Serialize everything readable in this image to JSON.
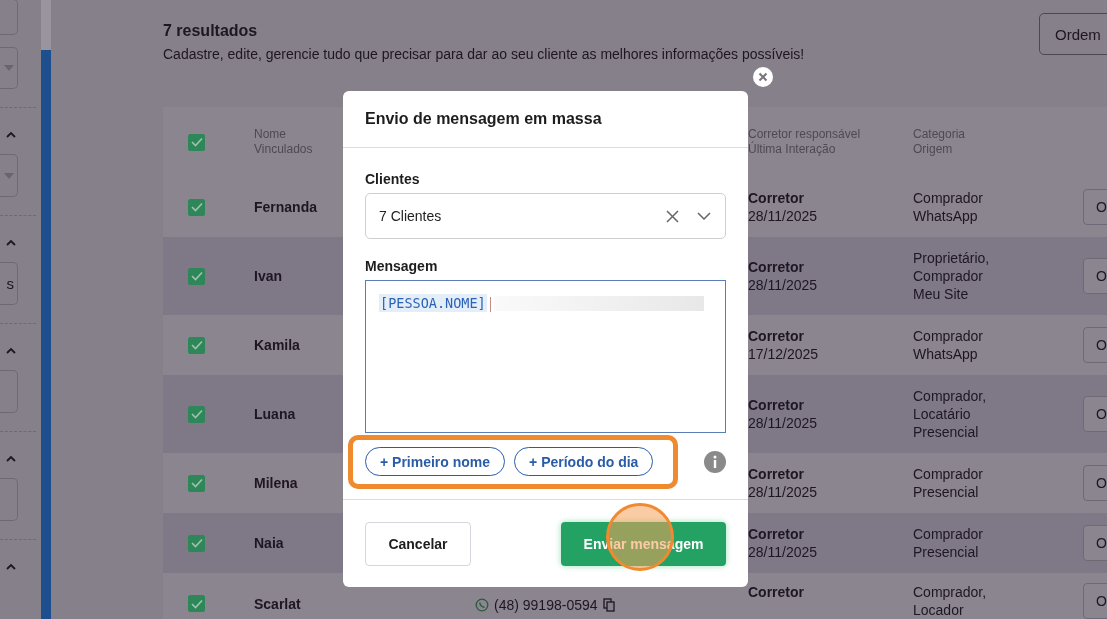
{
  "sidebar": {
    "field_text": "s"
  },
  "header": {
    "title": "7 resultados",
    "subtitle": "Cadastre, edite, gerencie tudo que precisar para dar ao seu cliente as melhores informações possíveis!",
    "sort_button": "Ordem"
  },
  "table": {
    "select_all_checked": true,
    "columns": [
      {
        "lines": [
          "Nome",
          "Vinculados"
        ]
      },
      {
        "lines": [
          "Corretor responsável",
          "Última Interação"
        ]
      },
      {
        "lines": [
          "Categoria",
          "Origem"
        ]
      }
    ],
    "rows": [
      {
        "checked": true,
        "name": "Fernanda",
        "broker": "Corretor",
        "date": "28/11/2025",
        "category": "Comprador",
        "origin": "WhatsApp",
        "action": "O"
      },
      {
        "checked": true,
        "name": "Ivan",
        "broker": "Corretor",
        "date": "28/11/2025",
        "category": "Proprietário, Comprador",
        "origin": "Meu Site",
        "action": "O"
      },
      {
        "checked": true,
        "name": "Kamila",
        "broker": "Corretor",
        "date": "17/12/2025",
        "category": "Comprador",
        "origin": "WhatsApp",
        "action": "O"
      },
      {
        "checked": true,
        "name": "Luana",
        "broker": "Corretor",
        "date": "28/11/2025",
        "category": "Comprador, Locatário",
        "origin": "Presencial",
        "action": "O"
      },
      {
        "checked": true,
        "name": "Milena",
        "broker": "Corretor",
        "date": "28/11/2025",
        "category": "Comprador",
        "origin": "Presencial",
        "action": "O"
      },
      {
        "checked": true,
        "name": "Naia",
        "broker": "Corretor",
        "date": "28/11/2025",
        "category": "Comprador",
        "origin": "Presencial",
        "action": "O"
      },
      {
        "checked": true,
        "name": "Scarlat",
        "phone": "(48) 99198-0594",
        "broker": "Corretor",
        "category": "Comprador, Locador",
        "action": "O"
      }
    ]
  },
  "modal": {
    "title": "Envio de mensagem em massa",
    "clients_label": "Clientes",
    "clients_value": "7 Clientes",
    "message_label": "Mensagem",
    "message_token": "[PESSOA.NOME]",
    "chips": [
      "+ Primeiro nome",
      "+ Período do dia"
    ],
    "cancel": "Cancelar",
    "send": "Enviar mensagem"
  }
}
